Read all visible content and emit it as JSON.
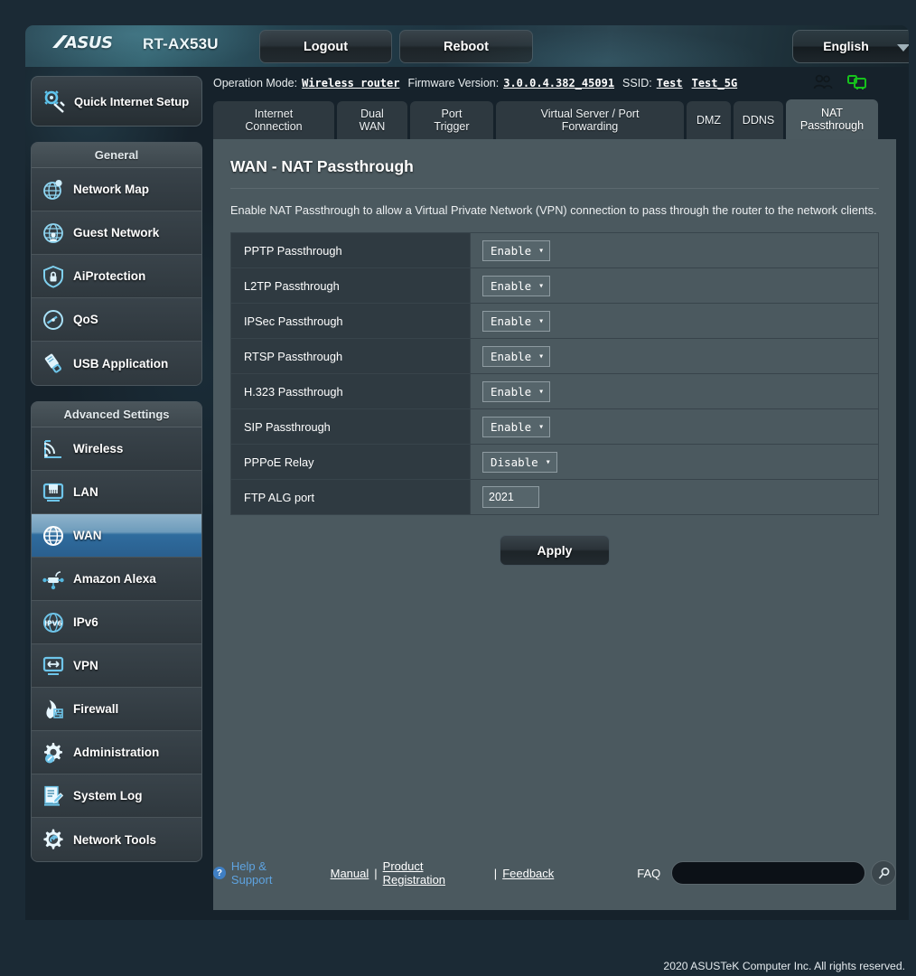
{
  "header": {
    "brand": "/ISUS",
    "model": "RT-AX53U",
    "logout_label": "Logout",
    "reboot_label": "Reboot",
    "language": "English"
  },
  "infobar": {
    "operation_mode_label": "Operation Mode:",
    "operation_mode_value": "Wireless router",
    "firmware_label": "Firmware Version:",
    "firmware_value": "3.0.0.4.382_45091",
    "ssid_label": "SSID:",
    "ssid_values": [
      "Test",
      "Test_5G"
    ]
  },
  "sidebar": {
    "quick_setup": "Quick Internet Setup",
    "general_label": "General",
    "general_items": [
      {
        "label": "Network Map",
        "icon": "network-map-icon"
      },
      {
        "label": "Guest Network",
        "icon": "guest-network-icon"
      },
      {
        "label": "AiProtection",
        "icon": "shield-lock-icon"
      },
      {
        "label": "QoS",
        "icon": "gauge-icon"
      },
      {
        "label": "USB Application",
        "icon": "usb-icon"
      }
    ],
    "advanced_label": "Advanced Settings",
    "advanced_items": [
      {
        "label": "Wireless",
        "icon": "wifi-icon",
        "active": false
      },
      {
        "label": "LAN",
        "icon": "lan-port-icon",
        "active": false
      },
      {
        "label": "WAN",
        "icon": "globe-icon",
        "active": true
      },
      {
        "label": "Amazon Alexa",
        "icon": "alexa-icon",
        "active": false
      },
      {
        "label": "IPv6",
        "icon": "ipv6-icon",
        "active": false
      },
      {
        "label": "VPN",
        "icon": "vpn-icon",
        "active": false
      },
      {
        "label": "Firewall",
        "icon": "firewall-flame-icon",
        "active": false
      },
      {
        "label": "Administration",
        "icon": "gear-wrench-icon",
        "active": false
      },
      {
        "label": "System Log",
        "icon": "log-pencil-icon",
        "active": false
      },
      {
        "label": "Network Tools",
        "icon": "gear-tools-icon",
        "active": false
      }
    ]
  },
  "tabs": [
    {
      "label": "Internet\nConnection",
      "active": false
    },
    {
      "label": "Dual\nWAN",
      "active": false
    },
    {
      "label": "Port\nTrigger",
      "active": false
    },
    {
      "label": "Virtual Server / Port\nForwarding",
      "active": false
    },
    {
      "label": "DMZ",
      "active": false
    },
    {
      "label": "DDNS",
      "active": false
    },
    {
      "label": "NAT\nPassthrough",
      "active": true
    }
  ],
  "page": {
    "title": "WAN - NAT Passthrough",
    "description": "Enable NAT Passthrough to allow a Virtual Private Network (VPN) connection to pass through the router to the network clients.",
    "apply_label": "Apply"
  },
  "settings": [
    {
      "key": "PPTP Passthrough",
      "type": "select",
      "value": "Enable"
    },
    {
      "key": "L2TP Passthrough",
      "type": "select",
      "value": "Enable"
    },
    {
      "key": "IPSec Passthrough",
      "type": "select",
      "value": "Enable"
    },
    {
      "key": "RTSP Passthrough",
      "type": "select",
      "value": "Enable"
    },
    {
      "key": "H.323 Passthrough",
      "type": "select",
      "value": "Enable"
    },
    {
      "key": "SIP Passthrough",
      "type": "select",
      "value": "Enable"
    },
    {
      "key": "PPPoE Relay",
      "type": "select",
      "value": "Disable"
    },
    {
      "key": "FTP ALG port",
      "type": "text",
      "value": "2021"
    }
  ],
  "footer": {
    "help_label": "Help & Support",
    "links": [
      "Manual",
      "Product Registration",
      "Feedback"
    ],
    "faq_label": "FAQ",
    "faq_value": "",
    "copyright": "2020 ASUSTeK Computer Inc. All rights reserved."
  },
  "colors": {
    "accent_blue": "#2f6c9e",
    "panel": "#4b595f",
    "key_cell": "#2f3a41",
    "page_bg": "#1b2a35",
    "link": "#5ea3e0"
  }
}
